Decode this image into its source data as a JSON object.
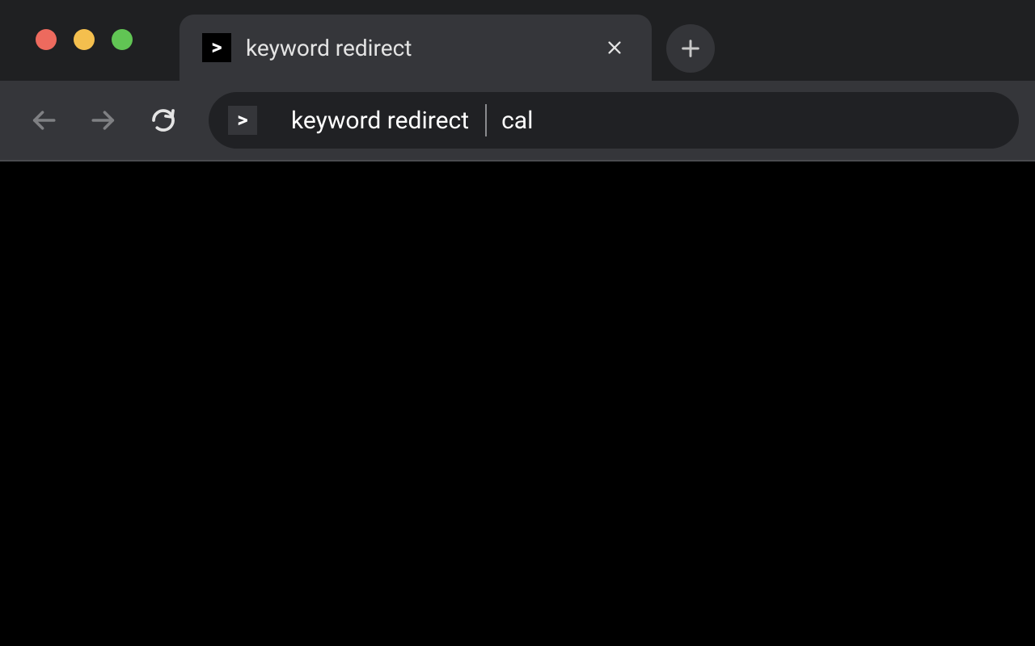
{
  "tab": {
    "title": "keyword redirect",
    "favicon_glyph": ">"
  },
  "omnibox": {
    "favicon_glyph": ">",
    "prefix": "keyword redirect",
    "query": "cal"
  },
  "colors": {
    "chrome_bg": "#1f2022",
    "toolbar_bg": "#35363a",
    "omnibox_bg": "#202124",
    "content_bg": "#000000"
  }
}
